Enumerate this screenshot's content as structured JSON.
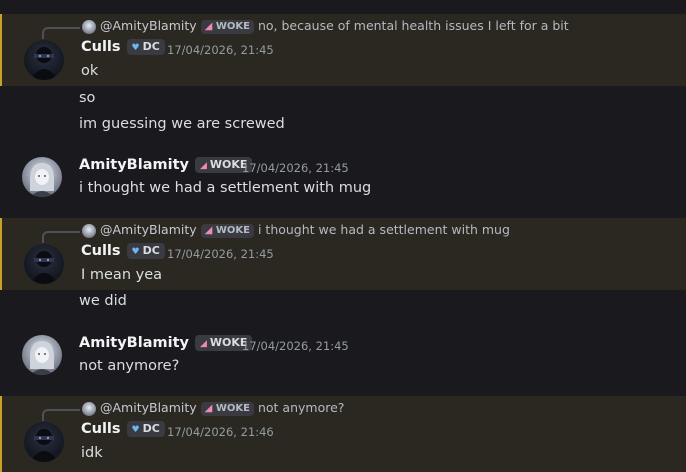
{
  "messages": [
    {
      "reply": {
        "name": "@AmityBlamity",
        "tag": "WOKE",
        "text": "no, because of mental health issues I left for a bit"
      },
      "author": "Culls",
      "tag": "DC",
      "time": "17/04/2026, 21:45",
      "lines": [
        "ok",
        "so",
        "im guessing we are screwed"
      ]
    },
    {
      "author": "AmityBlamity",
      "tag": "WOKE",
      "time": "17/04/2026, 21:45",
      "lines": [
        "i thought we had a settlement with mug"
      ]
    },
    {
      "reply": {
        "name": "@AmityBlamity",
        "tag": "WOKE",
        "text": "i thought we had a settlement with mug"
      },
      "author": "Culls",
      "tag": "DC",
      "time": "17/04/2026, 21:45",
      "lines": [
        "I mean yea",
        "we did"
      ]
    },
    {
      "author": "AmityBlamity",
      "tag": "WOKE",
      "time": "17/04/2026, 21:45",
      "lines": [
        "not anymore?"
      ]
    },
    {
      "reply": {
        "name": "@AmityBlamity",
        "tag": "WOKE",
        "text": "not anymore?"
      },
      "author": "Culls",
      "tag": "DC",
      "time": "17/04/2026, 21:46",
      "lines": [
        "idk"
      ]
    }
  ],
  "colors": {
    "highlight_bar": "#c9a227",
    "highlight_bg": "#2a2820",
    "background": "#1a1a1e"
  },
  "icons": {
    "woke_tag": "pink-heart-icon",
    "dc_tag": "blue-heart-icon"
  }
}
